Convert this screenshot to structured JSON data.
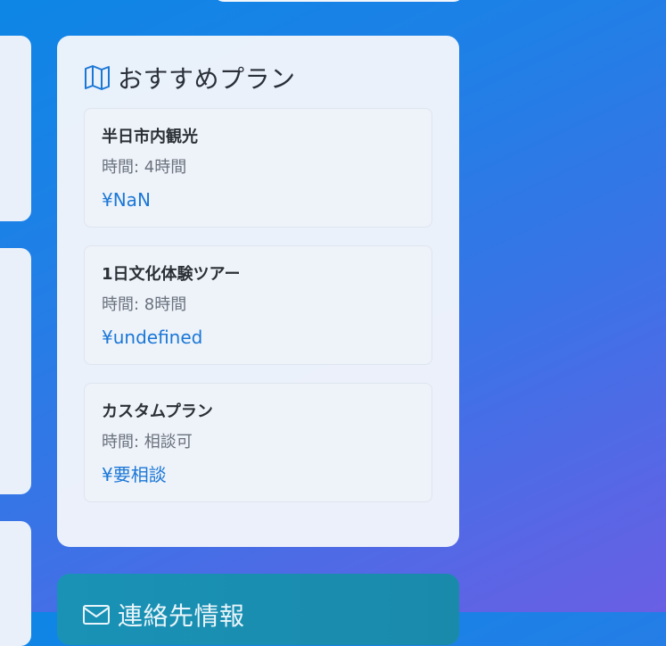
{
  "plans": {
    "title": "おすすめプラン",
    "icon": "map-icon",
    "items": [
      {
        "name": "半日市内観光",
        "duration": "時間: 4時間",
        "price": "¥NaN"
      },
      {
        "name": "1日文化体験ツアー",
        "duration": "時間: 8時間",
        "price": "¥undefined"
      },
      {
        "name": "カスタムプラン",
        "duration": "時間: 相談可",
        "price": "¥要相談"
      }
    ]
  },
  "contact": {
    "title": "連絡先情報",
    "icon": "mail-icon"
  },
  "colors": {
    "accent": "#1b77d6",
    "background_start": "#0d86e6",
    "background_end": "#6a5fe4",
    "contact_card": "#1992b6"
  }
}
